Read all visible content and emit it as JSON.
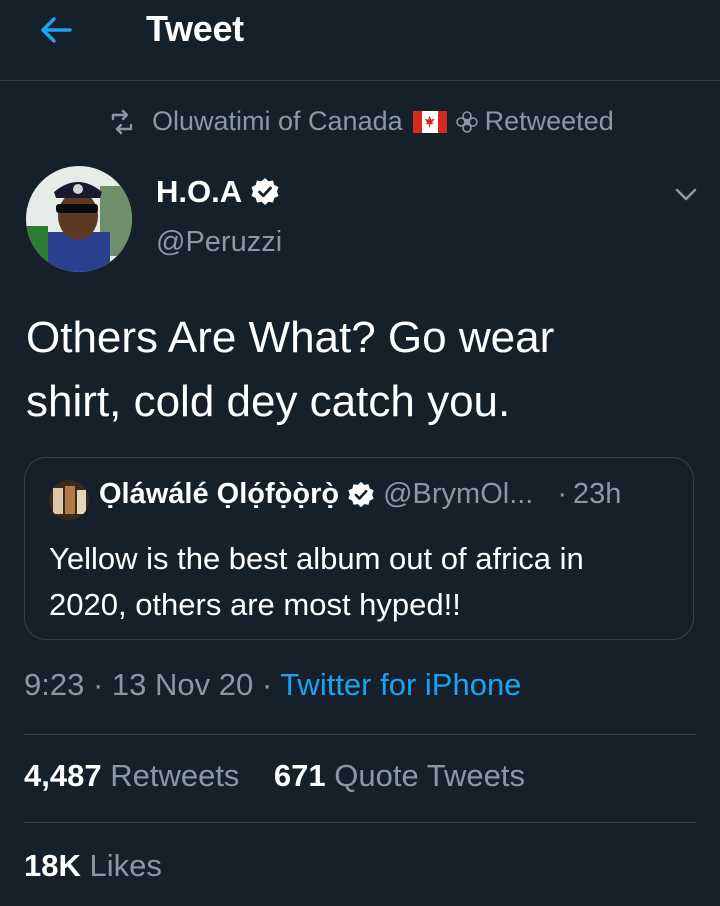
{
  "header": {
    "title": "Tweet",
    "back_icon": "arrow-left-icon"
  },
  "retweet": {
    "icon": "retweet-icon",
    "user": "Oluwatimi of Canada",
    "flag": "canada-flag-icon",
    "emoji": "flower-icon",
    "label": "Retweeted"
  },
  "tweet": {
    "author_name": "H.O.A",
    "author_handle": "@Peruzzi",
    "verified": true,
    "text": "Others Are What? Go wear\nshirt, cold dey catch you.",
    "timestamp": "9:23 · 13 Nov 20 · ",
    "source": "Twitter for iPhone"
  },
  "quote": {
    "author_name": "Ọláwálé  Ọlọ́fọ̀ọ̀rọ̀",
    "author_handle": "@BrymOl...",
    "time": "23h",
    "text": "Yellow is the best album out of africa in\n2020, others are most hyped!!"
  },
  "stats": {
    "retweets_count": "4,487",
    "retweets_label": "Retweets",
    "quotes_count": "671",
    "quotes_label": "Quote Tweets",
    "likes_count": "18K",
    "likes_label": "Likes"
  },
  "colors": {
    "background": "#15202b",
    "secondary_text": "#8899a6",
    "accent": "#1da1f2",
    "divider": "#38444d"
  }
}
